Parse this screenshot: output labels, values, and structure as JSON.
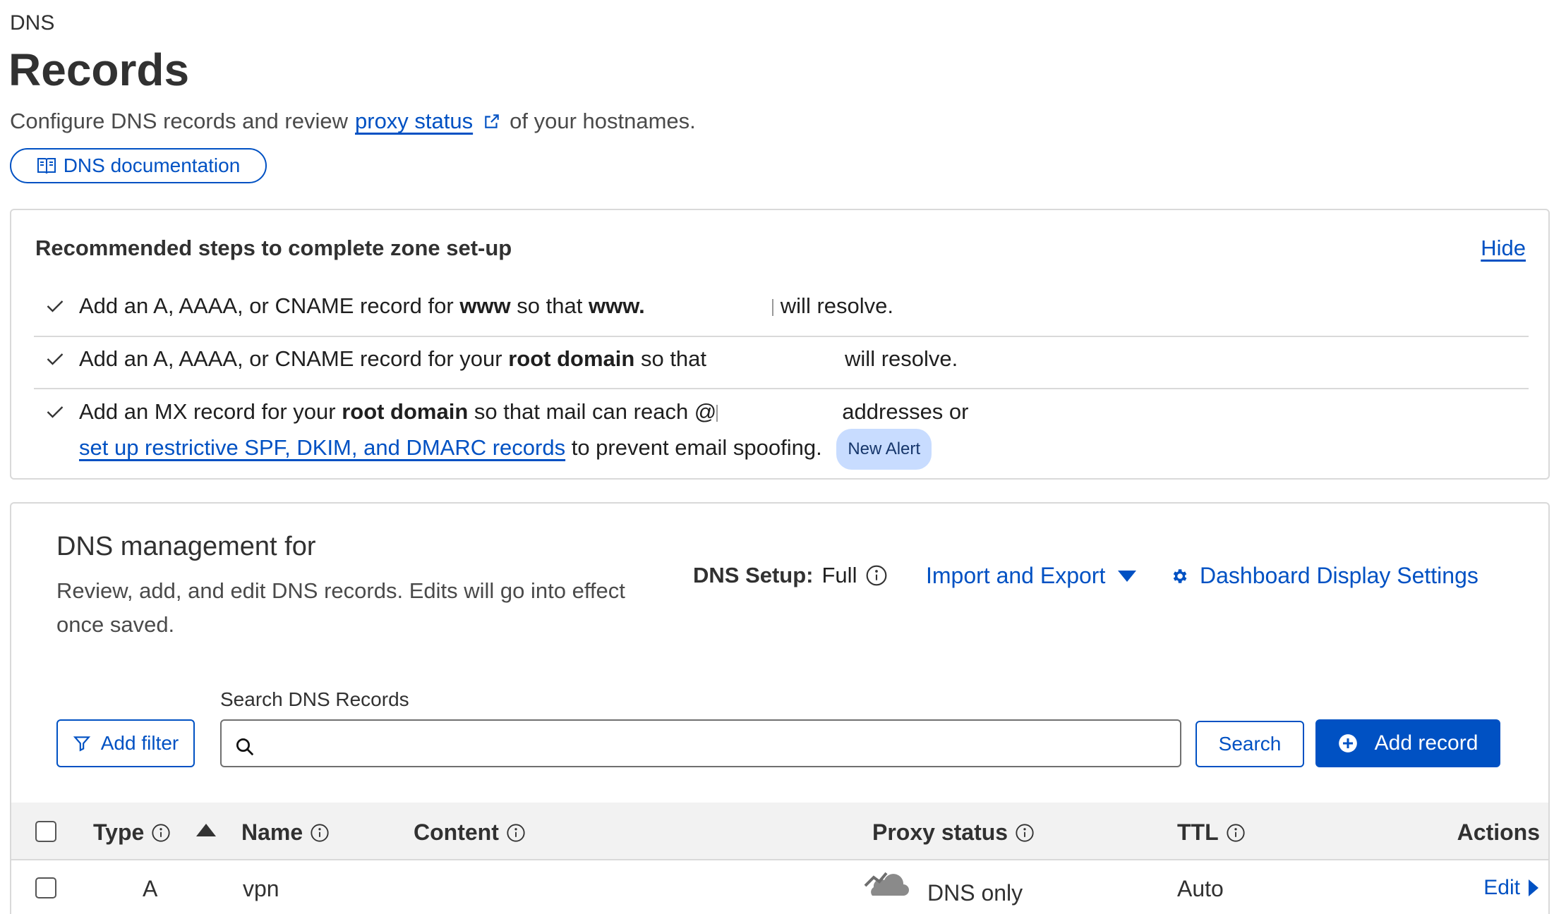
{
  "header": {
    "section": "DNS",
    "title": "Records",
    "intro_before": "Configure DNS records and review",
    "intro_link": "proxy status",
    "intro_after": "of your hostnames.",
    "doc_button": "DNS documentation"
  },
  "recommended": {
    "title": "Recommended steps to complete zone set-up",
    "hide_label": "Hide",
    "step1": {
      "a": "Add an A, AAAA, or CNAME record for",
      "b": "www",
      "c": "so that",
      "d": "www.",
      "e": "will resolve."
    },
    "step2": {
      "a": "Add an A, AAAA, or CNAME record for your",
      "b": "root domain",
      "c": "so that",
      "d": "will resolve."
    },
    "step3": {
      "a": "Add an MX record for your",
      "b": "root domain",
      "c": "so that mail can reach @",
      "d": "addresses or",
      "link": "set up restrictive SPF, DKIM, and DMARC records",
      "e": "to prevent email spoofing.",
      "badge": "New Alert"
    }
  },
  "management": {
    "title": "DNS management for",
    "description": "Review, add, and edit DNS records. Edits will go into effect once saved.",
    "setup_label": "DNS Setup:",
    "setup_value": "Full",
    "import_export": "Import and Export",
    "dashboard_settings": "Dashboard Display Settings",
    "search_label": "Search DNS Records",
    "search_value": "",
    "filter_button": "Add filter",
    "search_button": "Search",
    "add_button": "Add record"
  },
  "table": {
    "columns": {
      "type": "Type",
      "name": "Name",
      "content": "Content",
      "proxy": "Proxy status",
      "ttl": "TTL",
      "actions": "Actions"
    },
    "rows": [
      {
        "type": "A",
        "name": "vpn",
        "content": "",
        "proxy": "DNS only",
        "ttl": "Auto",
        "action": "Edit"
      }
    ]
  },
  "colors": {
    "accent": "#0051c3",
    "badge_bg": "#c8dcff",
    "table_header_bg": "#f2f2f2"
  },
  "icons": [
    "book-icon",
    "external-link-icon",
    "check-icon",
    "info-icon",
    "caret-down-icon",
    "gear-icon",
    "filter-icon",
    "search-icon",
    "plus-circle-icon",
    "sort-up-icon",
    "cloud-icon",
    "caret-right-icon"
  ]
}
